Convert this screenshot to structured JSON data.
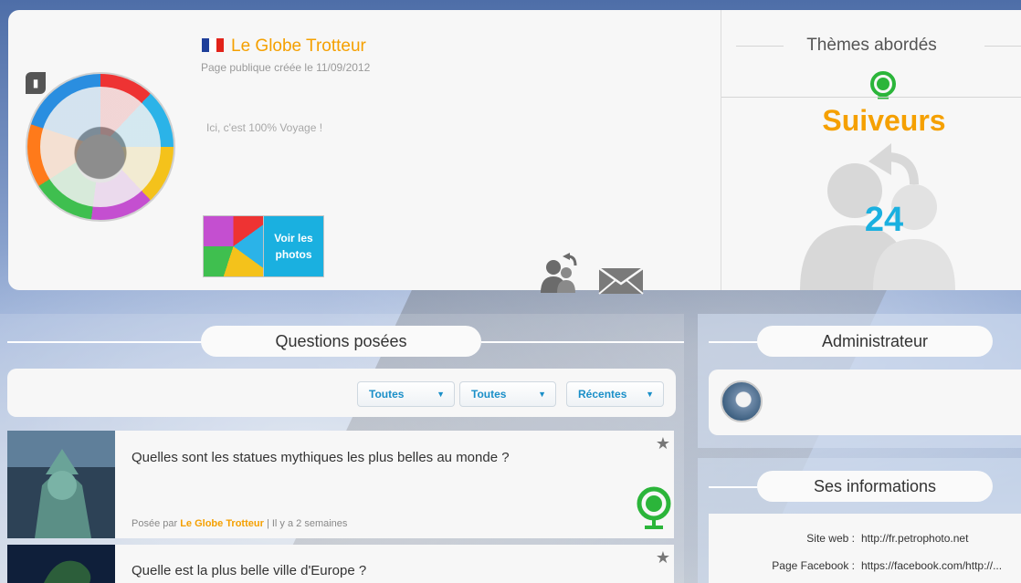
{
  "profile": {
    "name": "Le Globe Trotteur",
    "created": "Page publique créée le 11/09/2012",
    "description": "Ici, c'est 100% Voyage !",
    "photos_button": "Voir les\nphotos",
    "flag_colors": [
      "#1f3f9a",
      "#ffffff",
      "#e2231a"
    ],
    "icons": {
      "follow": "follow-icon",
      "mail": "mail-icon",
      "badge": "page-badge-icon"
    }
  },
  "sidebar": {
    "themes_title": "Thèmes abordés",
    "themes_icon": "globe-icon",
    "followers_title": "Suiveurs",
    "followers_count": "24"
  },
  "questions": {
    "section_title": "Questions posées",
    "filters": [
      {
        "label": "Toutes"
      },
      {
        "label": "Toutes"
      },
      {
        "label": "Récentes"
      }
    ],
    "items": [
      {
        "title": "Quelles sont les statues mythiques les plus belles au monde ?",
        "meta_prefix": "Posée par ",
        "author": "Le Globe Trotteur",
        "meta_suffix": " | Il y a 2 semaines",
        "theme_icon": "globe-icon"
      },
      {
        "title": "Quelle est la plus belle ville d'Europe ?"
      }
    ]
  },
  "administrator": {
    "section_title": "Administrateur"
  },
  "info": {
    "section_title": "Ses informations",
    "rows": [
      {
        "label": "Site web :",
        "value": "http://fr.petrophoto.net"
      },
      {
        "label": "Page Facebook :",
        "value": "https://facebook.com/http://..."
      }
    ]
  },
  "colors": {
    "accent_orange": "#f5a000",
    "accent_blue": "#1ab0e0",
    "theme_green": "#2bb53a"
  }
}
